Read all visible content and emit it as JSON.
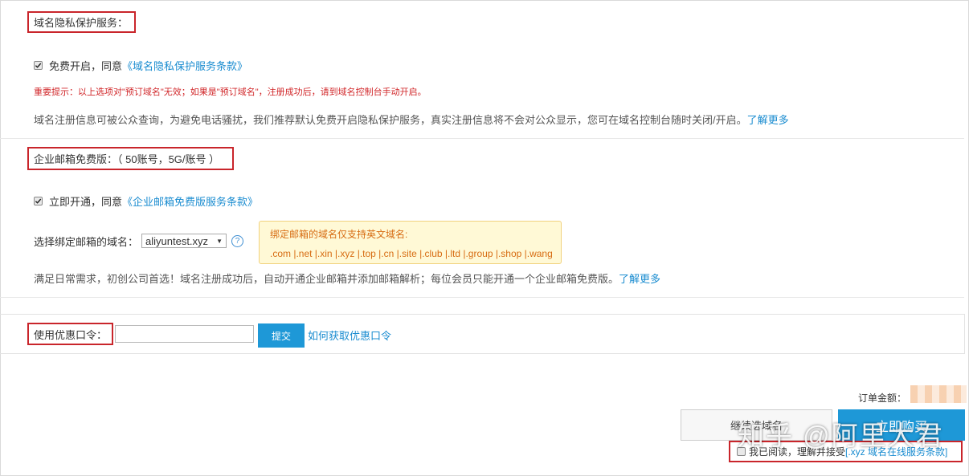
{
  "privacy": {
    "title": "域名隐私保护服务：",
    "checkbox_label": "免费开启，同意",
    "terms_link": "《域名隐私保护服务条款》",
    "warning": "重要提示：以上选项对\"预订域名\"无效；如果是\"预订域名\"，注册成功后，请到域名控制台手动开启。",
    "description": "域名注册信息可被公众查询，为避免电话骚扰，我们推荐默认免费开启隐私保护服务，真实注册信息将不会对公众显示，您可在域名控制台随时关闭/开启。",
    "learn_more": "了解更多"
  },
  "email": {
    "title": "企业邮箱免费版：（ 50账号，5G/账号 ）",
    "checkbox_label": "立即开通，同意",
    "terms_link": "《企业邮箱免费版服务条款》",
    "domain_select_label": "选择绑定邮箱的域名：",
    "domain_selected": "aliyuntest.xyz",
    "help_icon": "?",
    "tooltip": {
      "line1": "绑定邮箱的域名仅支持英文域名:",
      "line2": ".com |.net |.xin |.xyz |.top |.cn |.site |.club |.ltd |.group |.shop |.wang"
    },
    "description": "满足日常需求，初创公司首选！域名注册成功后，自动开通企业邮箱并添加邮箱解析；每位会员只能开通一个企业邮箱免费版。",
    "learn_more": "了解更多"
  },
  "coupon": {
    "label": "使用优惠口令：",
    "input_value": "",
    "submit_label": "提交",
    "how_to_link": "如何获取优惠口令"
  },
  "order": {
    "amount_label": "订单金额：",
    "continue_label": "继续选域名",
    "buy_label": "立即购买",
    "agree_text": "我已阅读，理解并接受",
    "agree_link": "[.xyz 域名在线服务条款]"
  },
  "watermark": "知乎 @阿里大君",
  "colors": {
    "accent": "#1e98d7",
    "link": "#1a8cd0",
    "warning": "#d1272a",
    "highlight_box": "#c9252b"
  }
}
